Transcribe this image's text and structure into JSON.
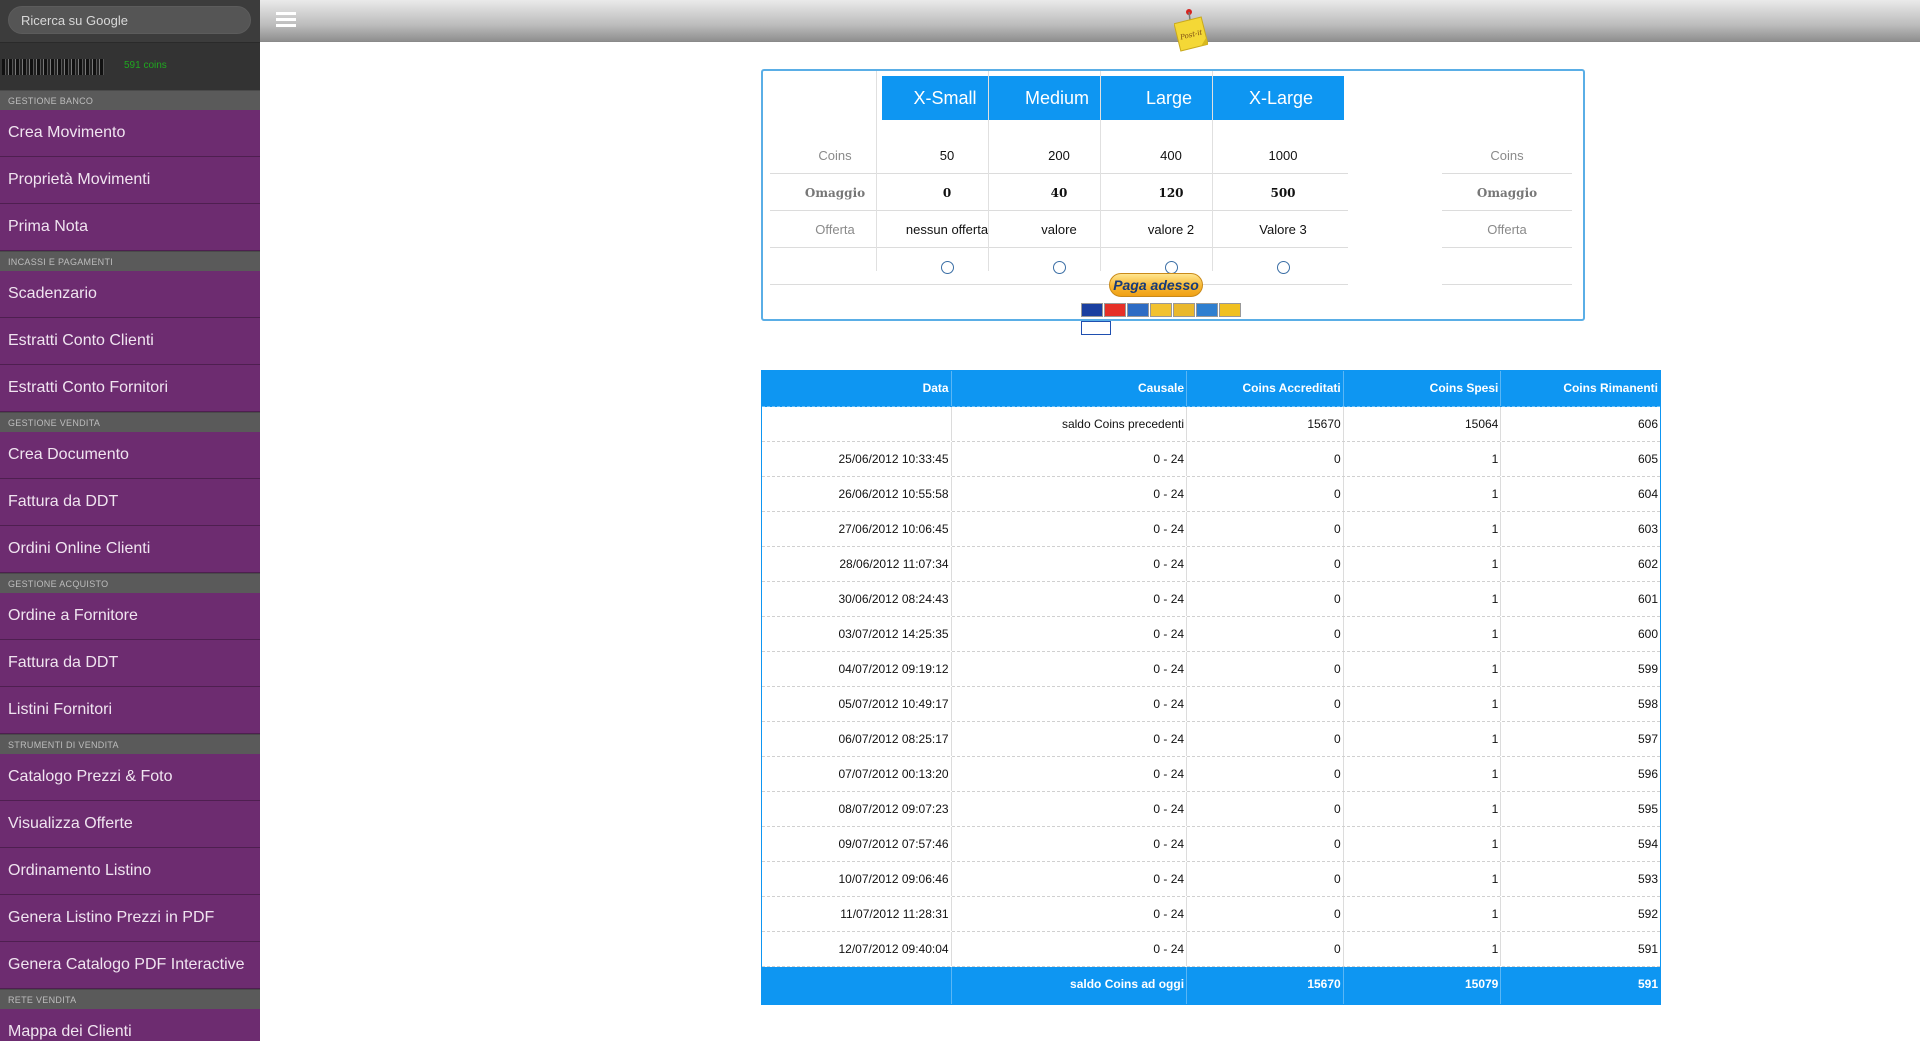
{
  "search": {
    "placeholder": "Ricerca su Google"
  },
  "user": {
    "coins": "591 coins"
  },
  "sidebar": [
    {
      "section": "GESTIONE BANCO",
      "items": [
        "Crea Movimento",
        "Proprietà Movimenti",
        "Prima Nota"
      ]
    },
    {
      "section": "INCASSI E PAGAMENTI",
      "items": [
        "Scadenzario",
        "Estratti Conto Clienti",
        "Estratti Conto Fornitori"
      ]
    },
    {
      "section": "GESTIONE VENDITA",
      "items": [
        "Crea Documento",
        "Fattura da DDT",
        "Ordini Online Clienti"
      ]
    },
    {
      "section": "GESTIONE ACQUISTO",
      "items": [
        "Ordine a Fornitore",
        "Fattura da DDT",
        "Listini Fornitori"
      ]
    },
    {
      "section": "STRUMENTI DI VENDITA",
      "items": [
        "Catalogo Prezzi & Foto",
        "Visualizza Offerte",
        "Ordinamento Listino",
        "Genera Listino Prezzi in PDF",
        "Genera Catalogo PDF Interactive"
      ]
    },
    {
      "section": "RETE VENDITA",
      "items": [
        "Mappa dei Clienti"
      ]
    }
  ],
  "topbar": {
    "menu_icon": "hamburger-menu-icon",
    "logo_icon": "post-it-note-icon",
    "logo_text": "Post-it"
  },
  "packages": {
    "row_labels": {
      "coins": "Coins",
      "omaggio": "Omaggio",
      "offerta": "Offerta"
    },
    "items": [
      {
        "name": "X-Small",
        "coins": "50",
        "omaggio": "0",
        "offerta": "nessun offerta"
      },
      {
        "name": "Medium",
        "coins": "200",
        "omaggio": "40",
        "offerta": "valore"
      },
      {
        "name": "Large",
        "coins": "400",
        "omaggio": "120",
        "offerta": "valore 2"
      },
      {
        "name": "X-Large",
        "coins": "1000",
        "omaggio": "500",
        "offerta": "Valore 3"
      }
    ],
    "pay_button": "Paga adesso",
    "card_icons": [
      "visa-card-icon",
      "mastercard-icon",
      "paypal-card-icon",
      "card-icon",
      "card-icon",
      "amex-card-icon",
      "postepay-card-icon",
      "ricarica-paypal-icon"
    ],
    "colors": {
      "header": "#0e96f2",
      "border": "#5aaee6"
    }
  },
  "movements": {
    "headers": [
      "Data",
      "Causale",
      "Coins Accreditati",
      "Coins Spesi",
      "Coins Rimanenti"
    ],
    "rows": [
      [
        "",
        "saldo Coins precedenti",
        "15670",
        "15064",
        "606"
      ],
      [
        "25/06/2012 10:33:45",
        "0 - 24",
        "0",
        "1",
        "605"
      ],
      [
        "26/06/2012 10:55:58",
        "0 - 24",
        "0",
        "1",
        "604"
      ],
      [
        "27/06/2012 10:06:45",
        "0 - 24",
        "0",
        "1",
        "603"
      ],
      [
        "28/06/2012 11:07:34",
        "0 - 24",
        "0",
        "1",
        "602"
      ],
      [
        "30/06/2012 08:24:43",
        "0 - 24",
        "0",
        "1",
        "601"
      ],
      [
        "03/07/2012 14:25:35",
        "0 - 24",
        "0",
        "1",
        "600"
      ],
      [
        "04/07/2012 09:19:12",
        "0 - 24",
        "0",
        "1",
        "599"
      ],
      [
        "05/07/2012 10:49:17",
        "0 - 24",
        "0",
        "1",
        "598"
      ],
      [
        "06/07/2012 08:25:17",
        "0 - 24",
        "0",
        "1",
        "597"
      ],
      [
        "07/07/2012 00:13:20",
        "0 - 24",
        "0",
        "1",
        "596"
      ],
      [
        "08/07/2012 09:07:23",
        "0 - 24",
        "0",
        "1",
        "595"
      ],
      [
        "09/07/2012 07:57:46",
        "0 - 24",
        "0",
        "1",
        "594"
      ],
      [
        "10/07/2012 09:06:46",
        "0 - 24",
        "0",
        "1",
        "593"
      ],
      [
        "11/07/2012 11:28:31",
        "0 - 24",
        "0",
        "1",
        "592"
      ],
      [
        "12/07/2012 09:40:04",
        "0 - 24",
        "0",
        "1",
        "591"
      ]
    ],
    "footer": [
      "",
      "saldo Coins ad oggi",
      "15670",
      "15079",
      "591"
    ],
    "colors": {
      "header": "#0e96f2"
    }
  }
}
